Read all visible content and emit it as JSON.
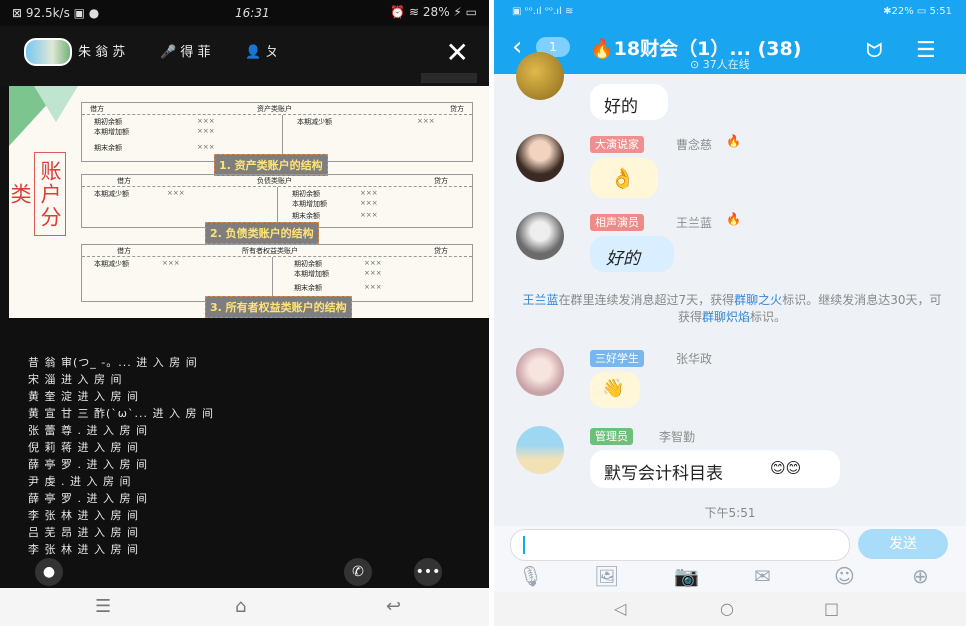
{
  "left": {
    "status": {
      "left": "⊠ 92.5k/s ▣ ●",
      "time": "16:31",
      "right": "⏰ ≋ 28% ⚡ ▭"
    },
    "top_bar": {
      "item1": "朱 翁 苏",
      "item2": "得 菲",
      "item3": "ㄆ"
    },
    "slide": {
      "side_label": "账户分类",
      "table1": {
        "left_head": "借方",
        "title": "资产类账户",
        "right_head": "贷方",
        "r1_label": "期初余额",
        "r1_val": "×××",
        "r1_right": "本期减少额",
        "r1_right_val": "×××",
        "r2_label": "本期增加额",
        "r2_val": "×××",
        "r3_label": "期末余额",
        "r3_val": "×××",
        "caption": "1. 资产类账户的结构"
      },
      "table2": {
        "left_head": "借方",
        "title": "负债类账户",
        "right_head": "贷方",
        "l1_label": "本期减少额",
        "l1_val": "×××",
        "r1_label": "期初余额",
        "r1_val": "×××",
        "r2_label": "本期增加额",
        "r2_val": "×××",
        "r3_label": "期末余额",
        "r3_val": "×××",
        "caption": "2. 负债类账户的结构"
      },
      "table3": {
        "left_head": "借方",
        "title": "所有者权益类账户",
        "right_head": "贷方",
        "l1_label": "本期减少额",
        "l1_val": "×××",
        "r1_label": "期初余额",
        "r1_val": "×××",
        "r2_label": "本期增加额",
        "r2_val": "×××",
        "r3_label": "期末余额",
        "r3_val": "×××",
        "caption": "3. 所有者权益类账户的结构"
      }
    },
    "messages": [
      "昔 翁 审(つ_ -。... 进 入 房 间",
      "宋 淄 进 入 房 间",
      "黄 奎 淀 进 入 房 间",
      "黄 宣 甘 三 酢(`ω`... 进 入 房 间",
      "张 蕾 尊 . 进 入 房 间",
      "倪 莉 蒋 进 入 房 间",
      "薛 亭 罗 . 进 入 房 间",
      "尹 虔 . 进 入 房 间",
      "薛 亭 罗 . 进 入 房 间",
      "李 张 林 进 入 房 间",
      "吕 芜 昂 进 入 房 间",
      "李 张 林 进 入 房 间"
    ]
  },
  "right": {
    "status": {
      "left": "▣ ᵒᵒ.ıl ᵒᵒ.ıl ≋",
      "right": "✱22% ▭ 5:51"
    },
    "header": {
      "back_badge": "1",
      "title": "18财会（1）...",
      "count": "(38)",
      "online": "37人在线"
    },
    "messages": {
      "m1_text": "好的",
      "m2_tag": "大演说家",
      "m2_name": "曹念慈",
      "m3_tag": "相声演员",
      "m3_name": "王兰蓝",
      "m3_text": "好的",
      "sys_name": "王兰蓝",
      "sys_text1": "在群里连续发消息超过7天，获得",
      "sys_badge1": "群聊之火",
      "sys_text2": "标识。继续发消息达30天，可获得",
      "sys_badge2": "群聊炽焰",
      "sys_text3": "标识。",
      "m4_tag": "三好学生",
      "m4_name": "张华政",
      "m5_tag": "管理员",
      "m5_name": "李智勤",
      "m5_text": "默写会计科目表",
      "time": "下午5:51"
    },
    "input": {
      "send_label": "发送"
    }
  }
}
